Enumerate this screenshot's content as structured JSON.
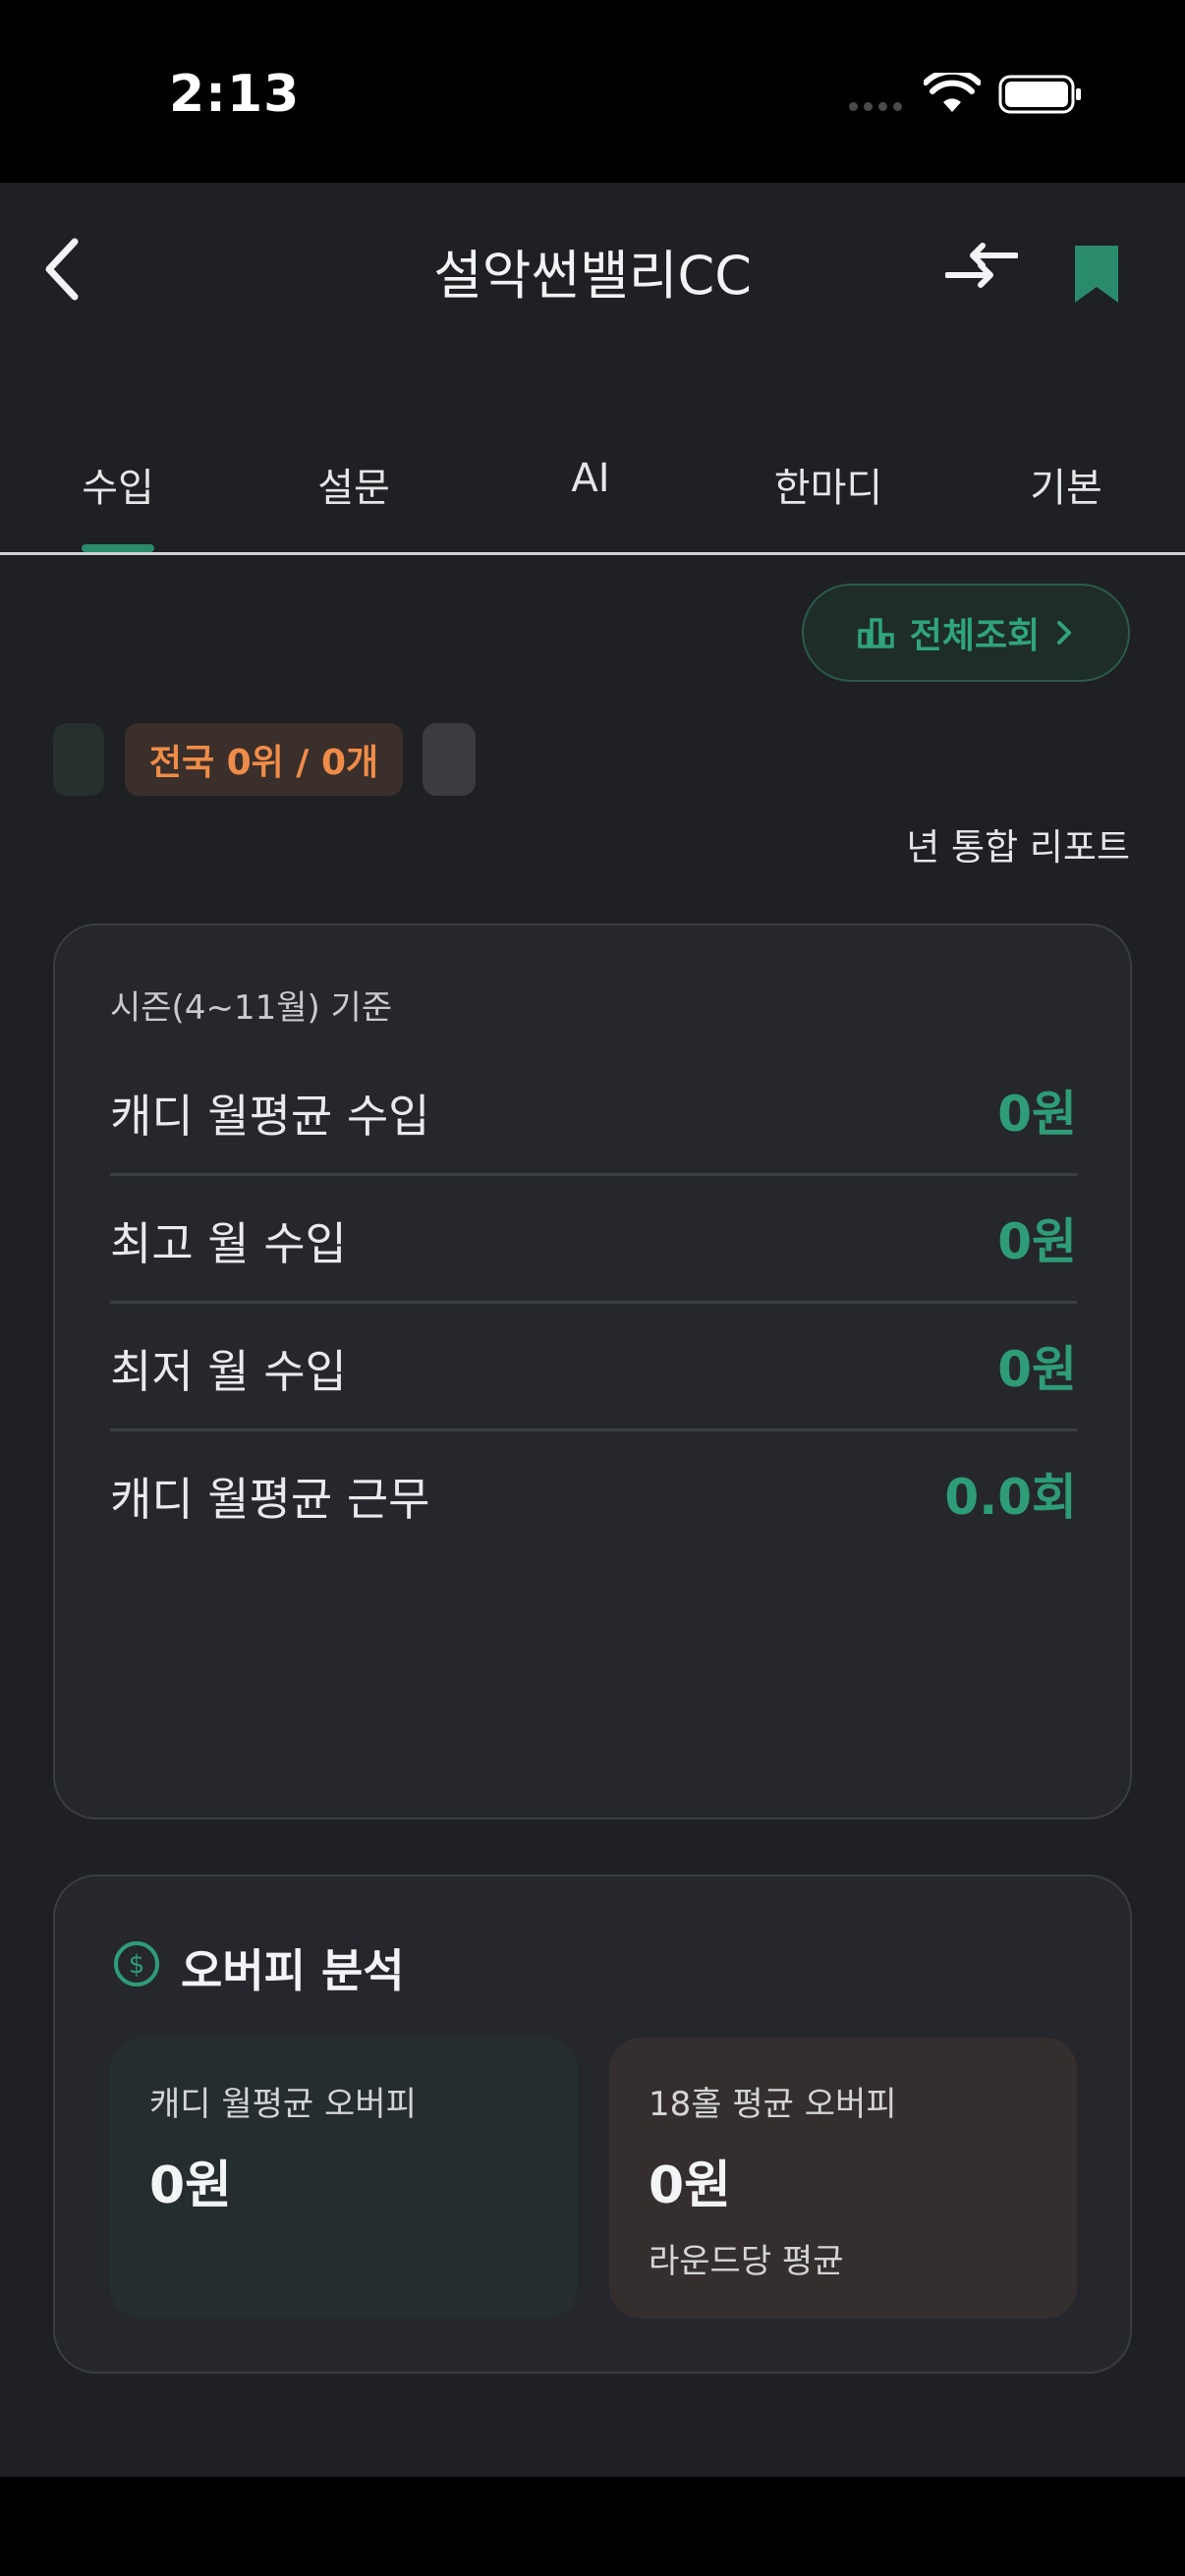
{
  "status_bar": {
    "time": "2:13"
  },
  "header": {
    "title": "설악썬밸리CC"
  },
  "tabs": [
    {
      "label": "수입",
      "active": true
    },
    {
      "label": "설문"
    },
    {
      "label": "AI"
    },
    {
      "label": "한마디"
    },
    {
      "label": "기본"
    }
  ],
  "view_all": {
    "label": "전체조회",
    "icon": "bar-chart-icon"
  },
  "rank_chip": {
    "label": "전국 0위 / 0개"
  },
  "report_label": "년 통합 리포트",
  "income": {
    "season_label": "시즌(4~11월) 기준",
    "rows": [
      {
        "label": "캐디 월평균 수입",
        "value": "0원"
      },
      {
        "label": "최고 월 수입",
        "value": "0원"
      },
      {
        "label": "최저 월 수입",
        "value": "0원"
      },
      {
        "label": "캐디 월평균 근무",
        "value": "0.0회"
      }
    ]
  },
  "overfee": {
    "title": "오버피 분석",
    "monthly": {
      "label": "캐디 월평균 오버피",
      "value": "0원"
    },
    "per_round": {
      "label": "18홀 평균 오버피",
      "value": "0원",
      "note": "라운드당 평균"
    }
  },
  "colors": {
    "accent": "#2e9c77",
    "rank": "#f08c49",
    "background": "#1e2024"
  }
}
